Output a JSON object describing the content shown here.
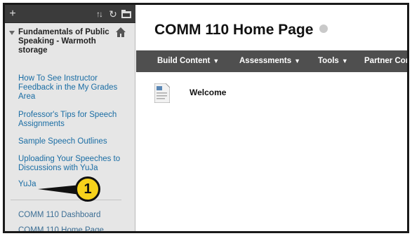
{
  "sidebar": {
    "toolbar": {
      "add_icon": "plus-icon",
      "sort_icon": "sort-icon",
      "refresh_icon": "refresh-icon",
      "folder_icon": "folder-icon"
    },
    "course_title": "Fundamentals of Public Speaking - Warmoth storage",
    "items": [
      {
        "label": "How To See Instructor Feedback in the My Grades Area"
      },
      {
        "label": "Professor's Tips for Speech Assignments"
      },
      {
        "label": "Sample Speech Outlines"
      },
      {
        "label": "Uploading Your Speeches to Discussions with YuJa"
      },
      {
        "label": "YuJa"
      },
      {
        "label": "COMM 110 Dashboard"
      },
      {
        "label": "COMM 110 Home Page"
      }
    ]
  },
  "callout": {
    "number": "1",
    "color": "#f6d21b"
  },
  "main": {
    "page_title": "COMM 110 Home Page",
    "menu": [
      {
        "label": "Build Content"
      },
      {
        "label": "Assessments"
      },
      {
        "label": "Tools"
      },
      {
        "label": "Partner Con"
      }
    ],
    "content_items": [
      {
        "title": "Welcome",
        "icon": "document-icon"
      }
    ]
  },
  "colors": {
    "link": "#1a6da4",
    "menubar": "#4f4f4f",
    "sidebar_bg": "#e6e6e6",
    "toolbar": "#3b3b3b"
  }
}
